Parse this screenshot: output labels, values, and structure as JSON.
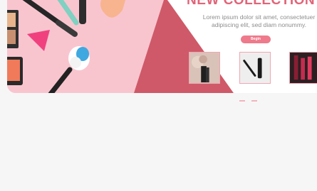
{
  "banner": {
    "headline": "NEW COLLECTION",
    "subtext": "Lorem ipsum dolor sit amet, consectetuer adipiscing elit, sed diam nonummy.",
    "button_label": "Begin",
    "thumbnails": [
      {
        "name": "brush-thumbnail"
      },
      {
        "name": "eyeliner-thumbnail"
      },
      {
        "name": "lipstick-thumbnail"
      }
    ]
  },
  "colors": {
    "accent": "#e06579",
    "panel_pink": "#f8c5cf",
    "panel_red": "#cf5968",
    "page_bg": "#f6f6f6"
  }
}
